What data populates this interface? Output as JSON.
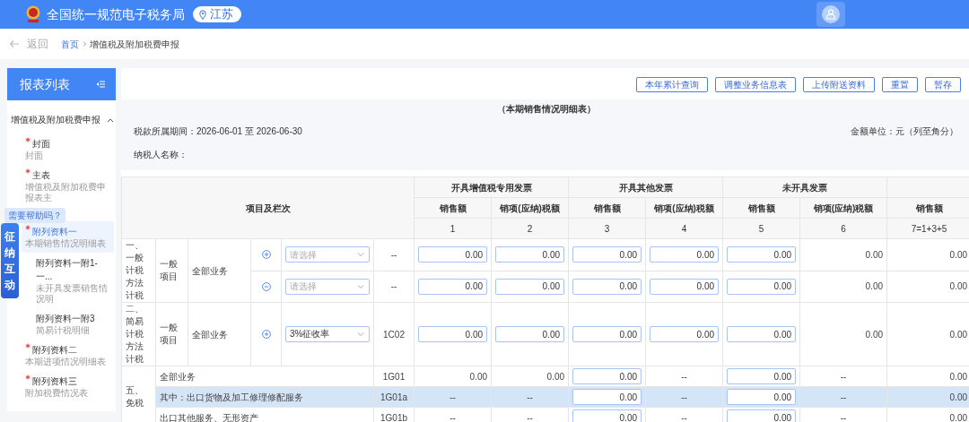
{
  "header": {
    "title": "全国统一规范电子税务局",
    "region": "江苏"
  },
  "breadcrumb": {
    "back": "返回",
    "items": [
      {
        "label": "首页",
        "link": true
      },
      {
        "label": "增值税及附加税费申报",
        "link": false
      }
    ]
  },
  "sidebar": {
    "title": "报表列表",
    "group": {
      "label": "增值税及附加税费申报",
      "expanded": true,
      "items": [
        {
          "title": "封面",
          "subtitle": "封面",
          "required": true,
          "selected": false
        },
        {
          "title": "主表",
          "subtitle": "增值税及附加税费申报表主",
          "required": true,
          "selected": false
        },
        {
          "title": "附列资料一",
          "subtitle": "本期销售情况明细表",
          "required": true,
          "selected": true,
          "children": [
            {
              "title": "附列资料一附1-一...",
              "subtitle": "未开具发票销售情况明",
              "required": false,
              "selected": false
            },
            {
              "title": "附列资料一附3",
              "subtitle": "简易计税明细",
              "required": false,
              "selected": false
            }
          ]
        },
        {
          "title": "附列资料二",
          "subtitle": "本期进项情况明细表",
          "required": true,
          "selected": false
        },
        {
          "title": "附列资料三",
          "subtitle": "附加税费情况表",
          "required": true,
          "selected": false
        }
      ]
    }
  },
  "assistant": {
    "bubble": "需要帮助吗？",
    "widget": "征纳互动"
  },
  "toolbar": {
    "buttons": [
      "本年累计查询",
      "调整业务信息表",
      "上传附送资料",
      "重置",
      "暂存"
    ]
  },
  "form": {
    "title": "（本期销售情况明细表）",
    "period": "税款所属期间：2026-06-01 至 2026-06-30",
    "unit": "金额单位：元（列至角分）",
    "taxpayer": "纳税人名称："
  },
  "table": {
    "item_header": "项目及栏次",
    "groups": [
      {
        "label": "开具增值税专用发票",
        "columns": [
          {
            "label": "销售额",
            "number": "1"
          },
          {
            "label": "销项(应纳)税额",
            "number": "2"
          }
        ]
      },
      {
        "label": "开具其他发票",
        "columns": [
          {
            "label": "销售额",
            "number": "3"
          },
          {
            "label": "销项(应纳)税额",
            "number": "4"
          }
        ]
      },
      {
        "label": "未开具发票",
        "columns": [
          {
            "label": "销售额",
            "number": "5"
          },
          {
            "label": "销项(应纳)税额",
            "number": "6"
          }
        ]
      },
      {
        "columns": [
          {
            "label": "销售额",
            "number": "7=1+3+5"
          }
        ]
      }
    ],
    "sections": [
      {
        "kind": "detailed",
        "label": "一、一般计税方法计税",
        "subcategory": "一般项目",
        "business": "全部业务",
        "rows": [
          {
            "kind": "add",
            "select": {
              "placeholder": "请选择"
            },
            "code": "--",
            "selected": false,
            "cells": [
              {
                "kind": "input",
                "value": "0.00"
              },
              {
                "kind": "input",
                "value": "0.00"
              },
              {
                "kind": "input",
                "value": "0.00"
              },
              {
                "kind": "input",
                "value": "0.00"
              },
              {
                "kind": "input",
                "value": "0.00"
              },
              {
                "kind": "text",
                "value": "0.00"
              },
              {
                "kind": "text",
                "value": "0.00"
              }
            ]
          },
          {
            "kind": "remove",
            "select": {
              "placeholder": "请选择"
            },
            "code": "--",
            "selected": false,
            "cells": [
              {
                "kind": "input",
                "value": "0.00"
              },
              {
                "kind": "input",
                "value": "0.00"
              },
              {
                "kind": "input",
                "value": "0.00"
              },
              {
                "kind": "input",
                "value": "0.00"
              },
              {
                "kind": "input",
                "value": "0.00"
              },
              {
                "kind": "text",
                "value": "0.00"
              },
              {
                "kind": "text",
                "value": "0.00"
              }
            ]
          }
        ]
      },
      {
        "kind": "detailed",
        "label": "二、简易计税方法计税",
        "subcategory": "一般项目",
        "business": "全部业务",
        "rows": [
          {
            "kind": "add",
            "select": {
              "value": "3%征收率"
            },
            "code": "1C02",
            "selected": false,
            "cells": [
              {
                "kind": "input",
                "value": "0.00"
              },
              {
                "kind": "input",
                "value": "0.00"
              },
              {
                "kind": "input",
                "value": "0.00"
              },
              {
                "kind": "input",
                "value": "0.00"
              },
              {
                "kind": "input",
                "value": "0.00"
              },
              {
                "kind": "text",
                "value": "0.00"
              },
              {
                "kind": "text",
                "value": "0.00"
              }
            ]
          }
        ]
      },
      {
        "kind": "exempt",
        "label": "五、免税",
        "rows": [
          {
            "label": "全部业务",
            "code": "1G01",
            "selected": false,
            "cells": [
              {
                "kind": "text",
                "value": "0.00"
              },
              {
                "kind": "text",
                "value": "0.00"
              },
              {
                "kind": "input",
                "value": "0.00"
              },
              {
                "kind": "text",
                "value": "--"
              },
              {
                "kind": "input",
                "value": "0.00"
              },
              {
                "kind": "text",
                "value": "--"
              },
              {
                "kind": "text",
                "value": "0.00"
              }
            ]
          },
          {
            "label": "其中：出口货物及加工修理修配服务",
            "code": "1G01a",
            "selected": true,
            "cells": [
              {
                "kind": "text",
                "value": "--"
              },
              {
                "kind": "text",
                "value": "--"
              },
              {
                "kind": "input",
                "value": "0.00"
              },
              {
                "kind": "text",
                "value": "--"
              },
              {
                "kind": "input",
                "value": "0.00"
              },
              {
                "kind": "text",
                "value": "--"
              },
              {
                "kind": "text",
                "value": "0.00"
              }
            ]
          },
          {
            "label": "出口其他服务、无形资产",
            "code": "1G01b",
            "selected": false,
            "cells": [
              {
                "kind": "text",
                "value": "--"
              },
              {
                "kind": "text",
                "value": "--"
              },
              {
                "kind": "input",
                "value": "0.00"
              },
              {
                "kind": "text",
                "value": "--"
              },
              {
                "kind": "input",
                "value": "0.00"
              },
              {
                "kind": "text",
                "value": "--"
              },
              {
                "kind": "text",
                "value": "0.00"
              }
            ]
          }
        ]
      }
    ]
  }
}
